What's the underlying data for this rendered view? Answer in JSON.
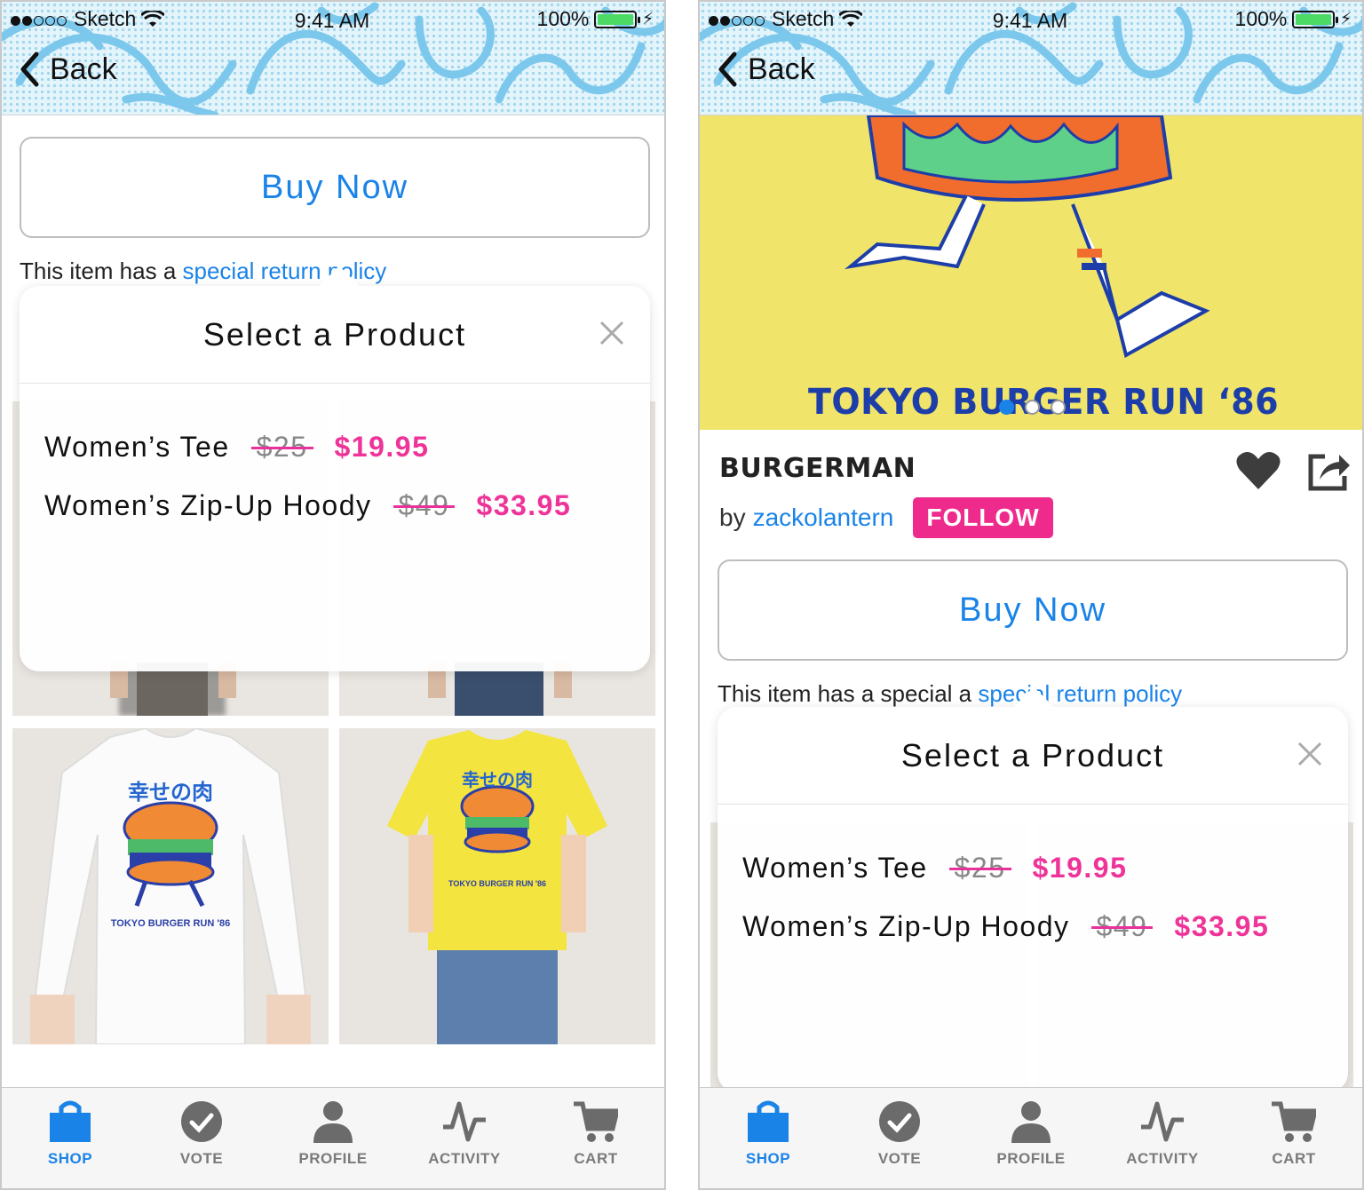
{
  "colors": {
    "accent_blue": "#1a83e8",
    "sale_pink": "#ee3399",
    "follow_pink": "#ee2b8c",
    "hero_yellow": "#f0e56a"
  },
  "left": {
    "status": {
      "carrier": "Sketch",
      "time": "9:41 AM",
      "battery": "100%"
    },
    "nav": {
      "back_label": "Back"
    },
    "buy_now_label": "Buy Now",
    "policy": {
      "prefix": "This item has a ",
      "link": "special return policy"
    },
    "popover": {
      "title": "Select a Product",
      "products": [
        {
          "name": "Women’s Tee",
          "old_price": "$25",
          "new_price": "$19.95"
        },
        {
          "name": "Women’s Zip-Up Hoody",
          "old_price": "$49",
          "new_price": "$33.95"
        }
      ]
    },
    "grid_products": [
      {
        "print_title": "幸せの肉",
        "print_caption": "TOKYO BURGER RUN '86"
      },
      {
        "print_title": "幸せの肉",
        "print_caption": "TOKYO BURGER RUN '86"
      }
    ],
    "tabs": [
      {
        "label": "SHOP",
        "icon": "shopping-bag-icon",
        "active": true
      },
      {
        "label": "VOTE",
        "icon": "checkmark-circle-icon",
        "active": false
      },
      {
        "label": "PROFILE",
        "icon": "person-icon",
        "active": false
      },
      {
        "label": "ACTIVITY",
        "icon": "activity-pulse-icon",
        "active": false
      },
      {
        "label": "CART",
        "icon": "cart-icon",
        "active": false
      }
    ]
  },
  "right": {
    "status": {
      "carrier": "Sketch",
      "time": "9:41 AM",
      "battery": "100%"
    },
    "nav": {
      "back_label": "Back"
    },
    "hero": {
      "artwork_text": "TOKYO BURGER RUN ‘86",
      "carousel_index": 1,
      "carousel_count": 3
    },
    "product": {
      "title": "BURGERMAN",
      "by": "by",
      "artist": "zackolantern",
      "follow_label": "FOLLOW"
    },
    "buy_now_label": "Buy Now",
    "policy": {
      "prefix": "This item has a special a ",
      "link": "special return policy"
    },
    "popover": {
      "title": "Select a Product",
      "products": [
        {
          "name": "Women’s Tee",
          "old_price": "$25",
          "new_price": "$19.95"
        },
        {
          "name": "Women’s Zip-Up Hoody",
          "old_price": "$49",
          "new_price": "$33.95"
        }
      ]
    },
    "tabs": [
      {
        "label": "SHOP",
        "icon": "shopping-bag-icon",
        "active": true
      },
      {
        "label": "VOTE",
        "icon": "checkmark-circle-icon",
        "active": false
      },
      {
        "label": "PROFILE",
        "icon": "person-icon",
        "active": false
      },
      {
        "label": "ACTIVITY",
        "icon": "activity-pulse-icon",
        "active": false
      },
      {
        "label": "CART",
        "icon": "cart-icon",
        "active": false
      }
    ]
  }
}
